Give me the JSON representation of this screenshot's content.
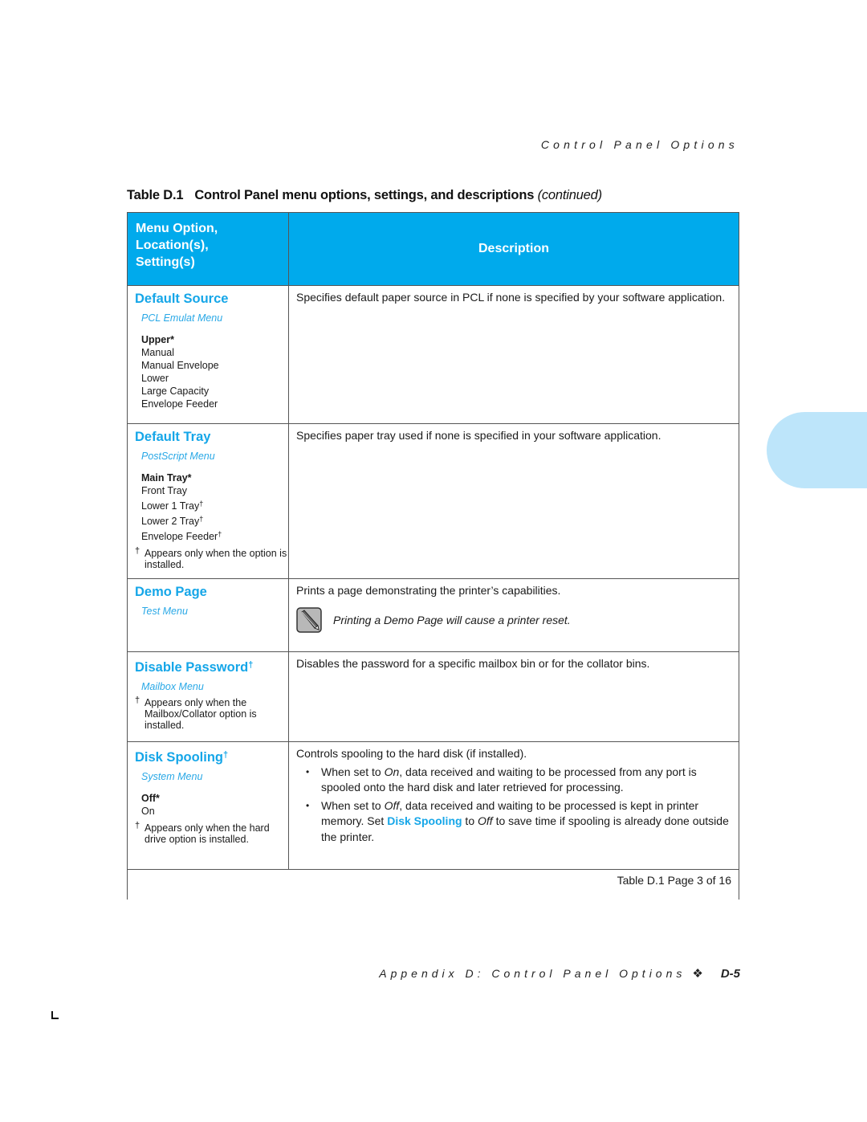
{
  "running_head": "Control Panel Options",
  "table_title": {
    "number": "Table D.1",
    "text": "Control Panel menu options, settings, and descriptions",
    "continued": "(continued)"
  },
  "table": {
    "headers": {
      "left": [
        "Menu Option,",
        "Location(s),",
        "Setting(s)"
      ],
      "right": "Description"
    },
    "rows": [
      {
        "option": "Default Source",
        "location": "PCL Emulat Menu",
        "default_setting": "Upper*",
        "settings": [
          "Manual",
          "Manual Envelope",
          "Lower",
          "Large Capacity",
          "Envelope Feeder"
        ],
        "description": "Specifies default paper source in PCL if none is specified by your software application."
      },
      {
        "option": "Default Tray",
        "location": "PostScript Menu",
        "default_setting": "Main Tray*",
        "settings": [
          "Front Tray",
          "Lower 1 Tray",
          "Lower 2 Tray",
          "Envelope Feeder"
        ],
        "dagger": "†",
        "footnote": "Appears only when the option is installed.",
        "description": "Specifies paper tray used if none is specified in your software application."
      },
      {
        "option": "Demo Page",
        "location": "Test Menu",
        "description": "Prints a page demonstrating the printer’s capabilities.",
        "note": "Printing a Demo Page will cause a printer reset."
      },
      {
        "option": "Disable Password",
        "dagger": "†",
        "location": "Mailbox Menu",
        "footnote": "Appears only when the Mailbox/Collator option is installed.",
        "description": "Disables the password for a specific mailbox bin or for the collator bins."
      },
      {
        "option": "Disk Spooling",
        "dagger": "†",
        "location": "System Menu",
        "default_setting": "Off*",
        "settings": [
          "On"
        ],
        "footnote": "Appears only when the hard drive option is installed.",
        "description": "Controls spooling to the hard disk (if installed).",
        "bullets": {
          "b1_pre": "When set to ",
          "b1_em": "On",
          "b1_post": ", data received and waiting to be processed from any port is spooled onto the hard disk and later retrieved for processing.",
          "b2_pre": "When set to ",
          "b2_em": "Off",
          "b2_mid": ", data received and waiting to be processed is kept in printer memory. Set ",
          "b2_ref": "Disk Spooling",
          "b2_to": " to ",
          "b2_em2": "Off",
          "b2_post": " to save time if spooling is already done outside the printer."
        }
      }
    ],
    "page_indicator": "Table D.1  Page 3 of 16"
  },
  "footer": {
    "text": "Appendix D: Control Panel Options",
    "separator": "❖",
    "page": "D-5"
  },
  "colors": {
    "header_bg": "#00aaec",
    "accent_text": "#15a6e8",
    "thumb_tab": "#bde5fa"
  }
}
